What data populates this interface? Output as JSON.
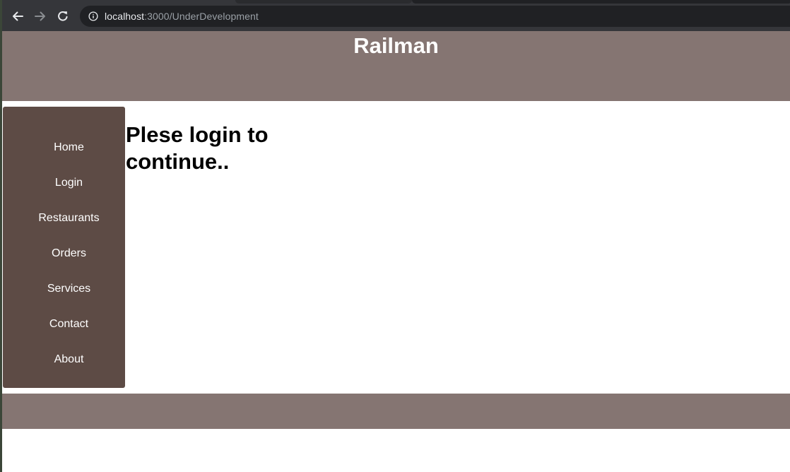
{
  "browser": {
    "url_host": "localhost",
    "url_rest": ":3000/UnderDevelopment"
  },
  "header": {
    "title": "Railman"
  },
  "sidebar": {
    "items": [
      {
        "label": "Home"
      },
      {
        "label": "Login"
      },
      {
        "label": "Restaurants"
      },
      {
        "label": "Orders"
      },
      {
        "label": "Services"
      },
      {
        "label": "Contact"
      },
      {
        "label": "About"
      }
    ]
  },
  "main": {
    "message": "Plese login to continue.."
  },
  "colors": {
    "header_bg": "#857572",
    "sidebar_bg": "#5d4b45",
    "footer_bg": "#857572",
    "chrome_bg": "#35363a"
  }
}
